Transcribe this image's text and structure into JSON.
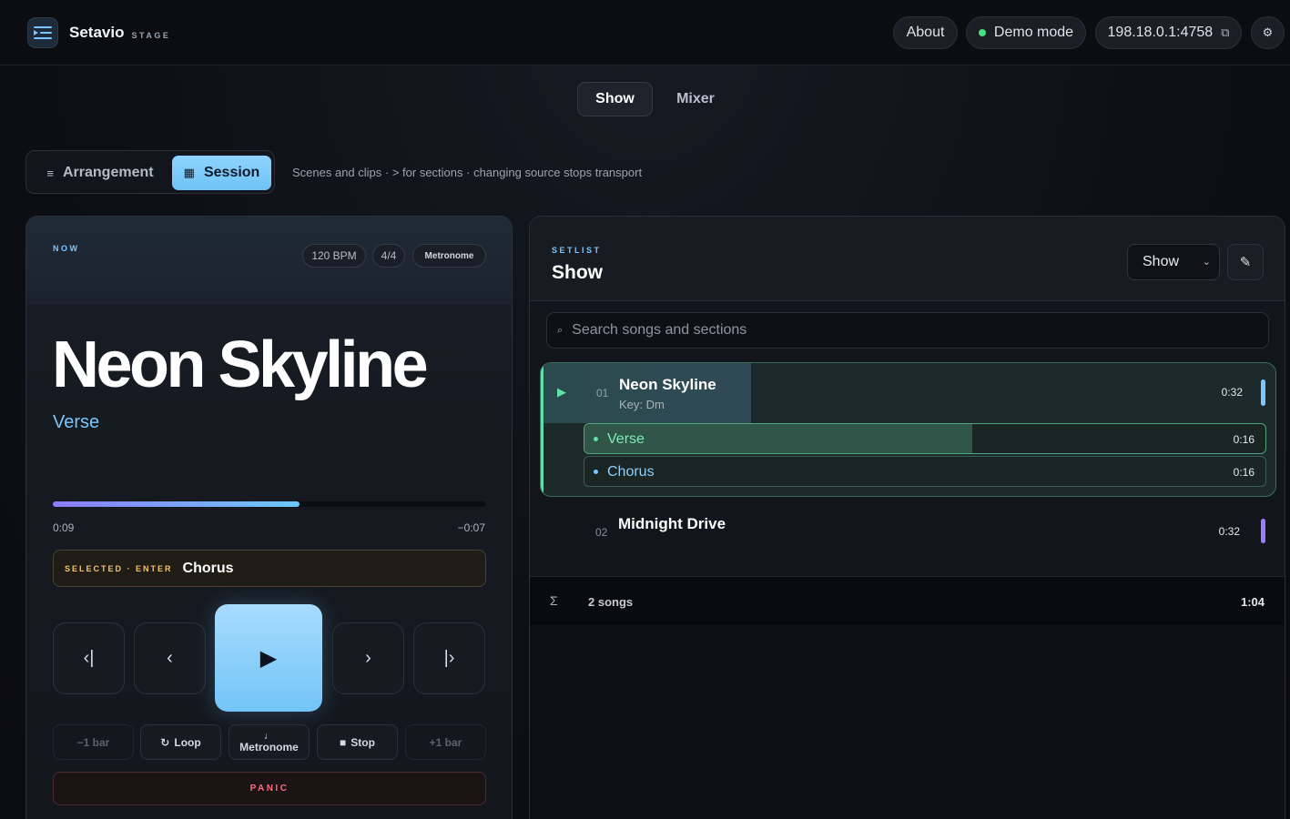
{
  "header": {
    "app_name": "Setavio",
    "app_sub": "STAGE",
    "about_label": "About",
    "demo_label": "Demo mode",
    "address": "198.18.0.1:4758",
    "copy_icon": "copy-icon",
    "settings_icon": "gear-icon"
  },
  "modes": {
    "show": "Show",
    "mixer": "Mixer",
    "active": "Show"
  },
  "view": {
    "arrangement": "Arrangement",
    "session": "Session",
    "active": "Session",
    "hint": "Scenes and clips · > for sections · changing source stops transport"
  },
  "now": {
    "label": "NOW",
    "bpm": "120 BPM",
    "signature": "4/4",
    "metronome_chip": "Metronome",
    "song_title": "Neon Skyline",
    "section": "Verse",
    "progress": 0.57,
    "elapsed": "0:09",
    "remaining": "−0:07",
    "selected_label": "SELECTED · ENTER",
    "selected_value": "Chorus",
    "transport": {
      "prev_song": "‹|",
      "prev_section": "‹",
      "play": "▶",
      "next_section": "›",
      "next_song": "|›"
    },
    "controls": {
      "minus_bar": "−1 bar",
      "loop": "Loop",
      "metronome": "Metronome",
      "stop": "Stop",
      "plus_bar": "+1 bar"
    },
    "panic": "PANIC"
  },
  "setlist": {
    "label": "SETLIST",
    "title": "Show",
    "select_value": "Show",
    "search_placeholder": "Search songs and sections",
    "songs": [
      {
        "num": "01",
        "name": "Neon Skyline",
        "key": "Key: Dm",
        "duration": "0:32",
        "progress": 0.28,
        "color": "#7cc6ff",
        "sections": [
          {
            "name": "Verse",
            "duration": "0:16",
            "progress": 0.57,
            "color": "#5fe0a6"
          },
          {
            "name": "Chorus",
            "duration": "0:16",
            "progress": 0,
            "color": "#7cc6ff"
          }
        ]
      },
      {
        "num": "02",
        "name": "Midnight Drive",
        "duration": "0:32",
        "color": "#9b7cff"
      }
    ],
    "totals": {
      "count": "2 songs",
      "total": "1:04"
    }
  },
  "colors": {
    "accent_blue": "#7cc6ff",
    "accent_green": "#5fe0a6",
    "accent_purple": "#9b7cff",
    "panic_red": "#ff6b7d",
    "selected_gold": "#f4c36b"
  }
}
